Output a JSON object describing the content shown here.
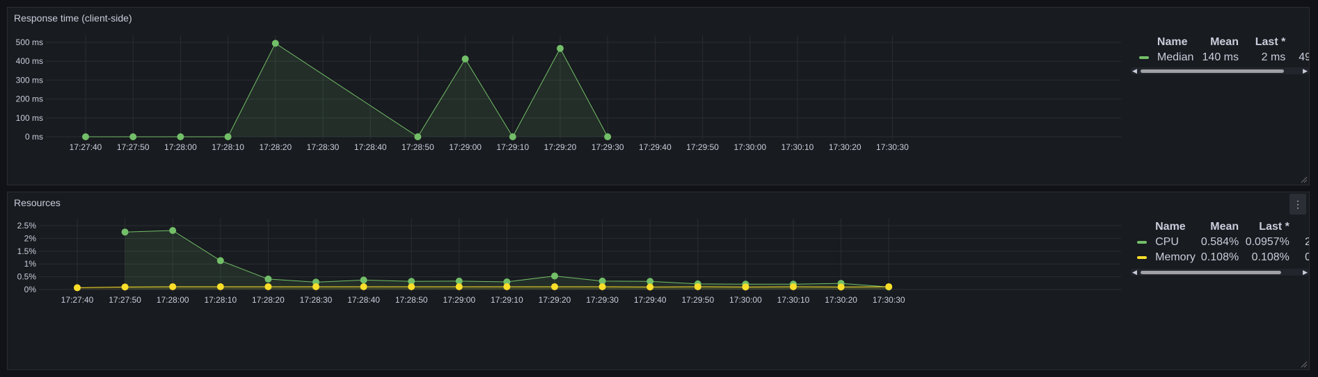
{
  "panels": [
    {
      "title": "Response time (client-side)",
      "legend": {
        "headers": [
          "Name",
          "Mean",
          "Last *"
        ],
        "rows": [
          {
            "name": "Median",
            "color": "#73bf69",
            "mean": "140 ms",
            "last": "2 ms",
            "extra": "49"
          }
        ]
      }
    },
    {
      "title": "Resources",
      "legend": {
        "headers": [
          "Name",
          "Mean",
          "Last *"
        ],
        "rows": [
          {
            "name": "CPU",
            "color": "#73bf69",
            "mean": "0.584%",
            "last": "0.0957%",
            "extra": "2"
          },
          {
            "name": "Memory",
            "color": "#fade2a",
            "mean": "0.108%",
            "last": "0.108%",
            "extra": "0"
          }
        ]
      }
    }
  ],
  "chart_data": [
    {
      "type": "line",
      "title": "Response time (client-side)",
      "ylim": [
        0,
        500
      ],
      "y_ticks": [
        "0 ms",
        "100 ms",
        "200 ms",
        "300 ms",
        "400 ms",
        "500 ms"
      ],
      "x_ticks": [
        "17:27:40",
        "17:27:50",
        "17:28:00",
        "17:28:10",
        "17:28:20",
        "17:28:30",
        "17:28:40",
        "17:28:50",
        "17:29:00",
        "17:29:10",
        "17:29:20",
        "17:29:30",
        "17:29:40",
        "17:29:50",
        "17:30:00",
        "17:30:10",
        "17:30:20",
        "17:30:30"
      ],
      "grid": true,
      "legend_position": "right",
      "series": [
        {
          "name": "Median",
          "color": "#73bf69",
          "points": [
            {
              "x": "17:27:40",
              "y": 0
            },
            {
              "x": "17:27:50",
              "y": 0
            },
            {
              "x": "17:28:00",
              "y": 0
            },
            {
              "x": "17:28:10",
              "y": 0
            },
            {
              "x": "17:28:20",
              "y": 495
            },
            {
              "x": "17:28:50",
              "y": 0
            },
            {
              "x": "17:29:00",
              "y": 412
            },
            {
              "x": "17:29:10",
              "y": 0
            },
            {
              "x": "17:29:20",
              "y": 468
            },
            {
              "x": "17:29:30",
              "y": 0
            }
          ]
        }
      ]
    },
    {
      "type": "line",
      "title": "Resources",
      "ylim": [
        0,
        2.5
      ],
      "y_ticks": [
        "0%",
        "0.5%",
        "1%",
        "1.5%",
        "2%",
        "2.5%"
      ],
      "x_ticks": [
        "17:27:40",
        "17:27:50",
        "17:28:00",
        "17:28:10",
        "17:28:20",
        "17:28:30",
        "17:28:40",
        "17:28:50",
        "17:29:00",
        "17:29:10",
        "17:29:20",
        "17:29:30",
        "17:29:40",
        "17:29:50",
        "17:30:00",
        "17:30:10",
        "17:30:20",
        "17:30:30"
      ],
      "grid": true,
      "legend_position": "right",
      "series": [
        {
          "name": "CPU",
          "color": "#73bf69",
          "points": [
            {
              "x": "17:27:50",
              "y": 2.25
            },
            {
              "x": "17:28:00",
              "y": 2.31
            },
            {
              "x": "17:28:10",
              "y": 1.13
            },
            {
              "x": "17:28:20",
              "y": 0.41
            },
            {
              "x": "17:28:30",
              "y": 0.29
            },
            {
              "x": "17:28:40",
              "y": 0.37
            },
            {
              "x": "17:28:50",
              "y": 0.32
            },
            {
              "x": "17:29:00",
              "y": 0.33
            },
            {
              "x": "17:29:10",
              "y": 0.3
            },
            {
              "x": "17:29:20",
              "y": 0.53
            },
            {
              "x": "17:29:30",
              "y": 0.33
            },
            {
              "x": "17:29:40",
              "y": 0.32
            },
            {
              "x": "17:29:50",
              "y": 0.22
            },
            {
              "x": "17:30:00",
              "y": 0.21
            },
            {
              "x": "17:30:10",
              "y": 0.21
            },
            {
              "x": "17:30:20",
              "y": 0.24
            },
            {
              "x": "17:30:30",
              "y": 0.1
            }
          ]
        },
        {
          "name": "Memory",
          "color": "#fade2a",
          "points": [
            {
              "x": "17:27:40",
              "y": 0.07
            },
            {
              "x": "17:27:50",
              "y": 0.1
            },
            {
              "x": "17:28:00",
              "y": 0.11
            },
            {
              "x": "17:28:10",
              "y": 0.11
            },
            {
              "x": "17:28:20",
              "y": 0.11
            },
            {
              "x": "17:28:30",
              "y": 0.11
            },
            {
              "x": "17:28:40",
              "y": 0.11
            },
            {
              "x": "17:28:50",
              "y": 0.11
            },
            {
              "x": "17:29:00",
              "y": 0.11
            },
            {
              "x": "17:29:10",
              "y": 0.11
            },
            {
              "x": "17:29:20",
              "y": 0.11
            },
            {
              "x": "17:29:30",
              "y": 0.11
            },
            {
              "x": "17:29:40",
              "y": 0.1
            },
            {
              "x": "17:29:50",
              "y": 0.11
            },
            {
              "x": "17:30:00",
              "y": 0.1
            },
            {
              "x": "17:30:10",
              "y": 0.11
            },
            {
              "x": "17:30:20",
              "y": 0.1
            },
            {
              "x": "17:30:30",
              "y": 0.11
            }
          ]
        }
      ]
    }
  ],
  "icons": {
    "menu": "vertical-ellipsis-icon",
    "resize": "resize-handle-icon",
    "scroll_left": "chevron-left-icon",
    "scroll_right": "chevron-right-icon"
  }
}
